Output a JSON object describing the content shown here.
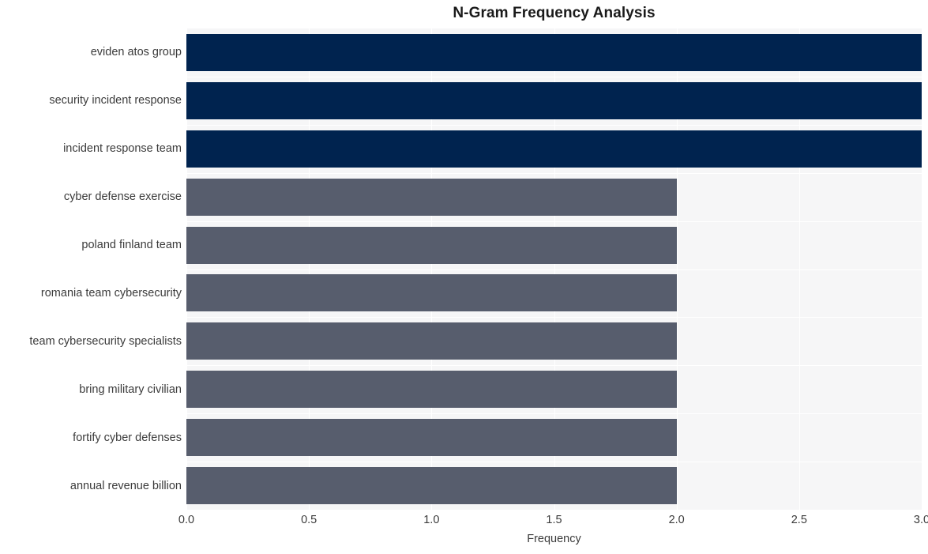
{
  "chart_data": {
    "type": "bar",
    "orientation": "horizontal",
    "title": "N-Gram Frequency Analysis",
    "xlabel": "Frequency",
    "ylabel": "",
    "xlim": [
      0.0,
      3.0
    ],
    "xticks": [
      "0.0",
      "0.5",
      "1.0",
      "1.5",
      "2.0",
      "2.5",
      "3.0"
    ],
    "xtick_values": [
      0.0,
      0.5,
      1.0,
      1.5,
      2.0,
      2.5,
      3.0
    ],
    "grid": true,
    "legend": "none",
    "categories": [
      "eviden atos group",
      "security incident response",
      "incident response team",
      "cyber defense exercise",
      "poland finland team",
      "romania team cybersecurity",
      "team cybersecurity specialists",
      "bring military civilian",
      "fortify cyber defenses",
      "annual revenue billion"
    ],
    "values": [
      3,
      3,
      3,
      2,
      2,
      2,
      2,
      2,
      2,
      2
    ],
    "bar_colors": [
      "#00234f",
      "#00234f",
      "#00234f",
      "#575d6d",
      "#575d6d",
      "#575d6d",
      "#575d6d",
      "#575d6d",
      "#575d6d",
      "#575d6d"
    ]
  },
  "style": {
    "plot_background": "#f6f6f7",
    "figure_background": "#ffffff",
    "grid_color": "#ffffff",
    "text_color": "#3b3b3b",
    "title_color": "#1a1a1a"
  }
}
